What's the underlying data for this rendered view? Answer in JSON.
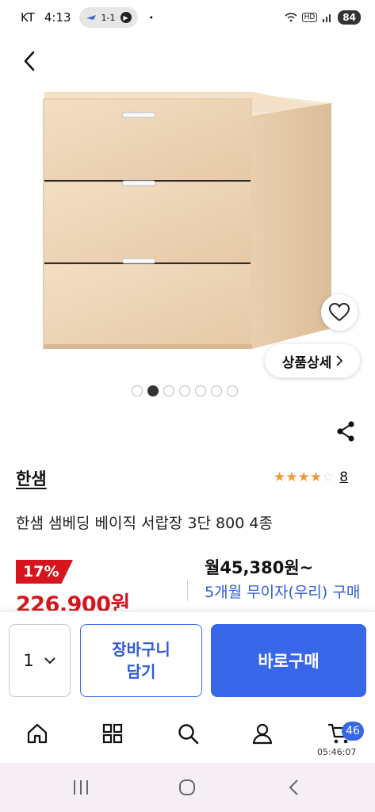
{
  "status_bar": {
    "carrier": "KT",
    "time": "4:13",
    "pill_text": "1-1",
    "bullet": "•",
    "network": "HD",
    "battery": "84"
  },
  "product": {
    "slide_count": 7,
    "active_slide": 2,
    "detail_button": "상품상세",
    "brand": "한샘",
    "rating_stars": 4,
    "review_count": "8",
    "title": "한샘 샘베딩 베이직 서랍장 3단 800 4종",
    "discount": "17%",
    "price": "226,900원",
    "monthly_price": "월45,380원~",
    "installment": "5개월 무이자(우리) 구매 >"
  },
  "buy_bar": {
    "quantity": "1",
    "cart_label": "장바구니\n담기",
    "buy_label": "바로구매"
  },
  "tab_bar": {
    "items": [
      "home-icon",
      "grid-icon",
      "search-icon",
      "user-icon",
      "cart-icon"
    ],
    "cart_badge": "46",
    "clock": "05:46:07"
  },
  "colors": {
    "accent": "#3766e8",
    "sale": "#d6151e",
    "star": "#f29a38"
  }
}
